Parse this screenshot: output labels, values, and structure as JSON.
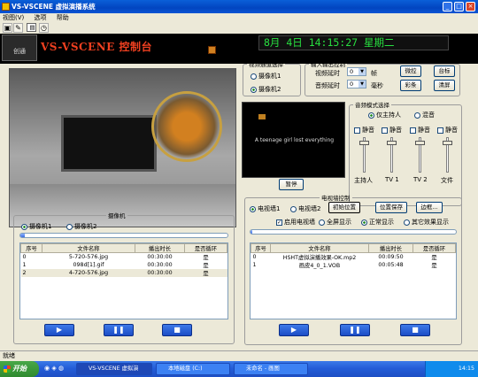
{
  "window": {
    "title": "VS-VSCENE 虚拟演播系统"
  },
  "menu": [
    "视图(V)",
    "选项",
    "帮助"
  ],
  "banner": {
    "logo": "创通",
    "title": "VS-VSCENE 控制台",
    "clock": "8月 4日 14:15:27 星期二"
  },
  "video_channel": {
    "legend": "视频通道选择",
    "options": [
      "摄像机1",
      "摄像机2"
    ],
    "selected": 1
  },
  "io_control": {
    "legend": "输入输出控制",
    "video_delay_label": "视频延时",
    "video_delay": "0",
    "video_unit": "帧",
    "audio_delay_label": "音频延时",
    "audio_delay": "0",
    "audio_unit": "毫秒",
    "buttons": [
      "微控",
      "台标",
      "彩条",
      "清屏"
    ]
  },
  "preview": {
    "text": "A teenage girl lost everything",
    "button": "暂停"
  },
  "audio_mode": {
    "legend": "音频模式选择",
    "options": [
      "仅主持人",
      "混音"
    ],
    "selected": 0,
    "mute_label": "静音",
    "channels": [
      "主持人",
      "TV 1",
      "TV 2",
      "文件"
    ]
  },
  "camera_panel": {
    "legend": "摄像机",
    "options": [
      "摄像机1",
      "摄像机2"
    ],
    "selected": 0,
    "progress": 0.02,
    "columns": [
      "序号",
      "文件名称",
      "播出时长",
      "是否循环"
    ],
    "rows": [
      [
        "0",
        "5-720-576.jpg",
        "00:30:00",
        "是"
      ],
      [
        "1",
        "098d[1].gif",
        "00:30:00",
        "是"
      ],
      [
        "2",
        "4-720-576.jpg",
        "00:30:00",
        "是"
      ]
    ]
  },
  "tv_wall": {
    "legend": "电视墙控制",
    "options": [
      "电视墙1",
      "电视墙2"
    ],
    "selected": 0,
    "buttons": [
      "初始位置",
      "位置保存",
      "边框..."
    ],
    "enable_label": "启用电视墙",
    "enable": true,
    "display_options": [
      "全屏显示",
      "正常显示",
      "其它效果显示"
    ],
    "display_selected": 1,
    "progress": 0.01,
    "columns": [
      "序号",
      "文件名称",
      "播出时长",
      "是否循环"
    ],
    "rows": [
      [
        "0",
        "HSHT虚拟演播效果-OK.mp2",
        "00:09:50",
        "是"
      ],
      [
        "1",
        "画皮4_0_1.VOB",
        "00:05:48",
        "是"
      ]
    ]
  },
  "playback_icons": [
    "play-icon",
    "pause-icon",
    "stop-icon"
  ],
  "status": "就绪",
  "taskbar": {
    "start": "开始",
    "tasks": [
      "VS-VSCENE 虚拟演",
      "本地磁盘 (C:)",
      "未命名 - 画图"
    ],
    "clock": "14:15"
  }
}
